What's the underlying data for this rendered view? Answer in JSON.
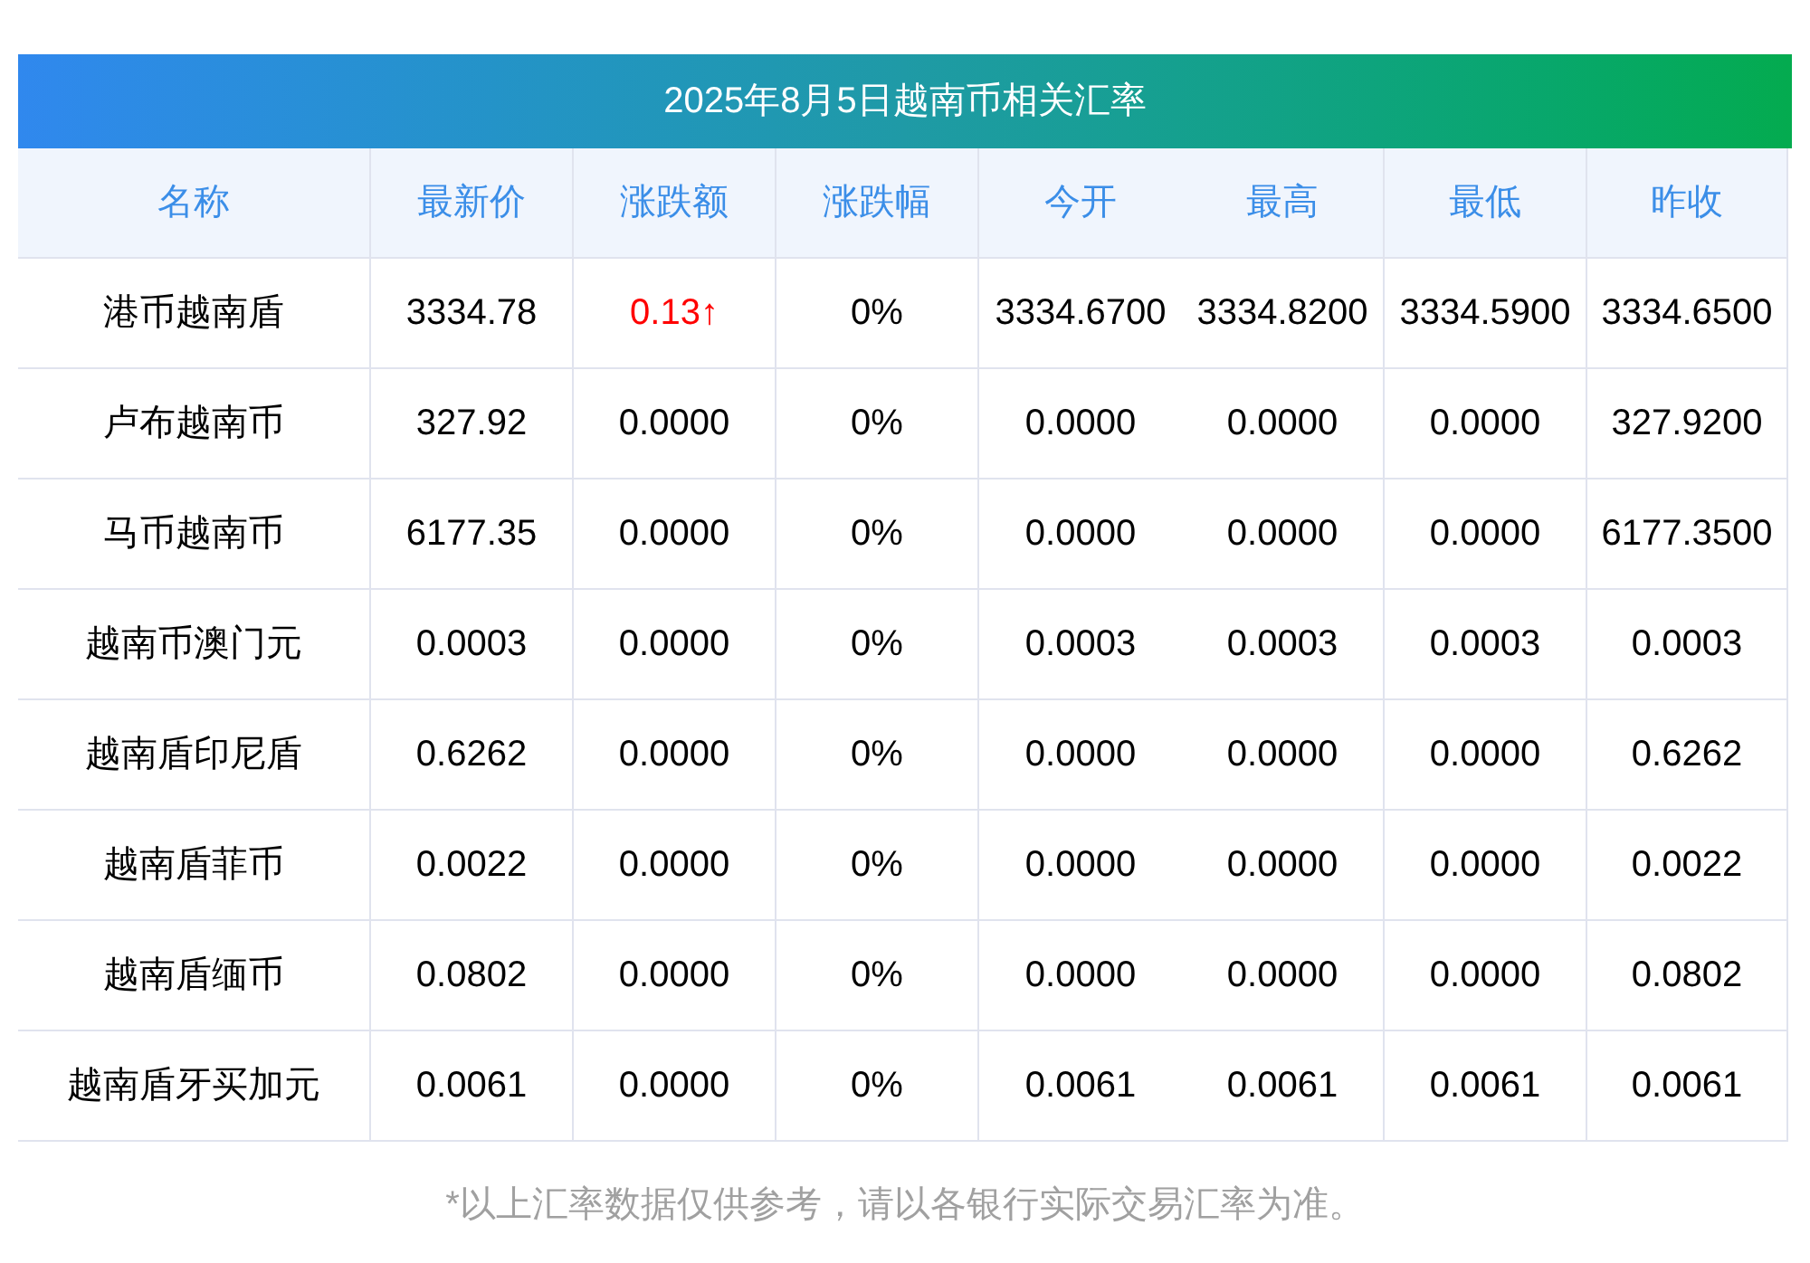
{
  "title": "2025年8月5日越南币相关汇率",
  "columns": [
    "名称",
    "最新价",
    "涨跌额",
    "涨跌幅",
    "今开",
    "最高",
    "最低",
    "昨收"
  ],
  "rows": [
    {
      "rising": true,
      "cells": [
        "港币越南盾",
        "3334.78",
        "0.13↑",
        "0%",
        "3334.6700",
        "3334.8200",
        "3334.5900",
        "3334.6500"
      ]
    },
    {
      "rising": false,
      "cells": [
        "卢布越南币",
        "327.92",
        "0.0000",
        "0%",
        "0.0000",
        "0.0000",
        "0.0000",
        "327.9200"
      ]
    },
    {
      "rising": false,
      "cells": [
        "马币越南币",
        "6177.35",
        "0.0000",
        "0%",
        "0.0000",
        "0.0000",
        "0.0000",
        "6177.3500"
      ]
    },
    {
      "rising": false,
      "cells": [
        "越南币澳门元",
        "0.0003",
        "0.0000",
        "0%",
        "0.0003",
        "0.0003",
        "0.0003",
        "0.0003"
      ]
    },
    {
      "rising": false,
      "cells": [
        "越南盾印尼盾",
        "0.6262",
        "0.0000",
        "0%",
        "0.0000",
        "0.0000",
        "0.0000",
        "0.6262"
      ]
    },
    {
      "rising": false,
      "cells": [
        "越南盾菲币",
        "0.0022",
        "0.0000",
        "0%",
        "0.0000",
        "0.0000",
        "0.0000",
        "0.0022"
      ]
    },
    {
      "rising": false,
      "cells": [
        "越南盾缅币",
        "0.0802",
        "0.0000",
        "0%",
        "0.0000",
        "0.0000",
        "0.0000",
        "0.0802"
      ]
    },
    {
      "rising": false,
      "cells": [
        "越南盾牙买加元",
        "0.0061",
        "0.0000",
        "0%",
        "0.0061",
        "0.0061",
        "0.0061",
        "0.0061"
      ]
    }
  ],
  "footnote": "*以上汇率数据仅供参考，请以各银行实际交易汇率为准。"
}
